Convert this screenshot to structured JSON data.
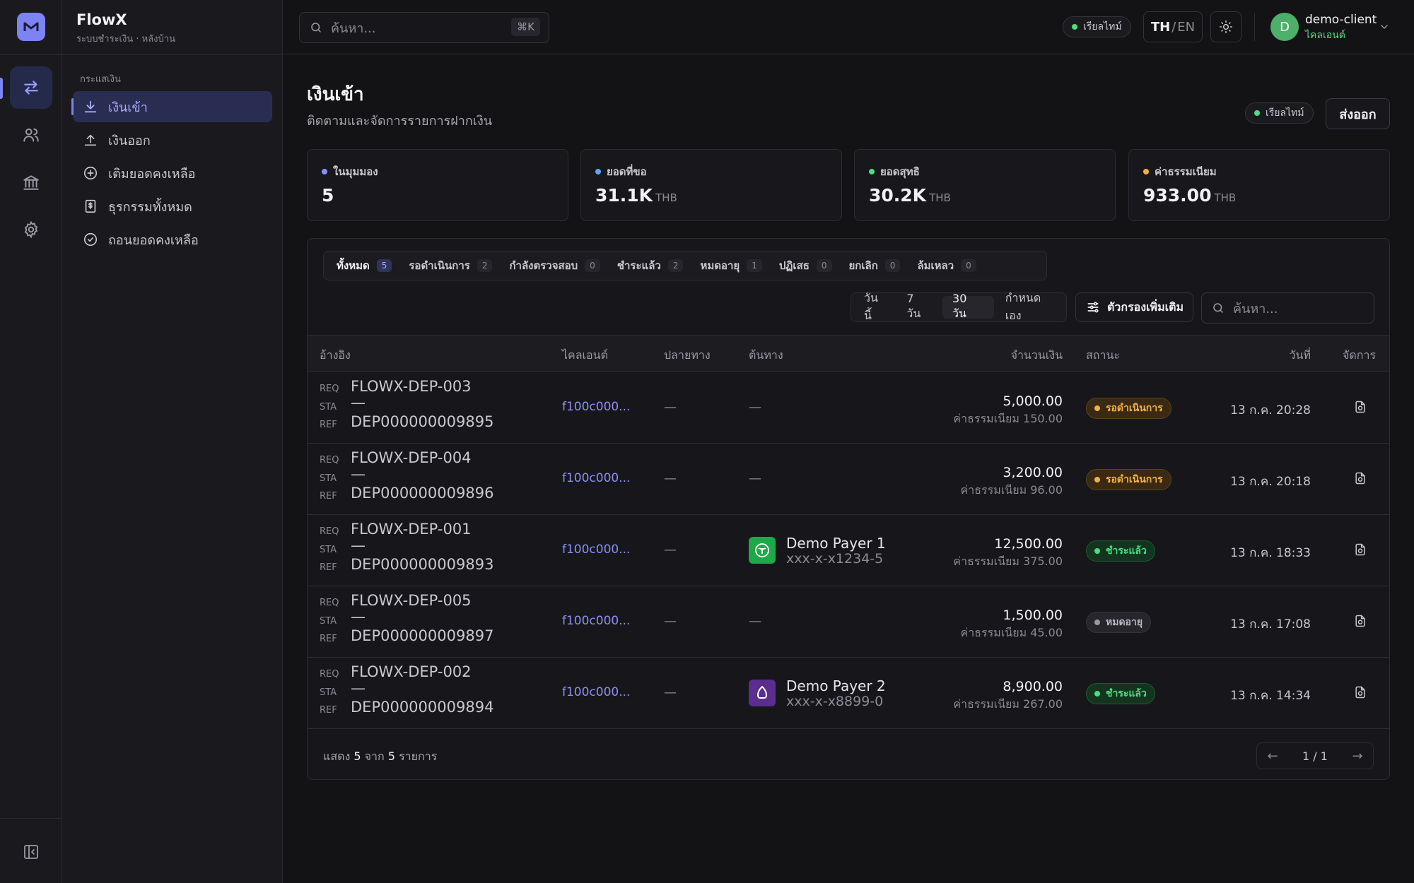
{
  "app": {
    "name": "FlowX",
    "subtitle": "ระบบชำระเงิน · หลังบ้าน"
  },
  "sidebar": {
    "section": "กระแสเงิน",
    "items": [
      {
        "label": "เงินเข้า",
        "icon": "download-icon",
        "active": true
      },
      {
        "label": "เงินออก",
        "icon": "upload-icon"
      },
      {
        "label": "เติมยอดคงเหลือ",
        "icon": "plus-circle-icon"
      },
      {
        "label": "ธุรกรรมทั้งหมด",
        "icon": "receipt-icon"
      },
      {
        "label": "ถอนยอดคงเหลือ",
        "icon": "check-circle-icon"
      }
    ]
  },
  "topbar": {
    "search_placeholder": "ค้นหา...",
    "search_shortcut": "⌘K",
    "live_label": "เรียลไทม์",
    "lang_active": "TH",
    "lang_sep": "/",
    "lang_other": "EN",
    "user": {
      "initial": "D",
      "name": "demo-client",
      "role": "ไคลเอนต์"
    }
  },
  "page": {
    "title": "เงินเข้า",
    "subtitle": "ติดตามและจัดการรายการฝากเงิน",
    "live_label": "เรียลไทม์",
    "export_label": "ส่งออก"
  },
  "stats": [
    {
      "label": "ในมุมมอง",
      "value": "5",
      "unit": "",
      "color": "#8b8ff5"
    },
    {
      "label": "ยอดที่ขอ",
      "value": "31.1K",
      "unit": "THB",
      "color": "#60a5fa"
    },
    {
      "label": "ยอดสุทธิ",
      "value": "30.2K",
      "unit": "THB",
      "color": "#4ade80"
    },
    {
      "label": "ค่าธรรมเนียม",
      "value": "933.00",
      "unit": "THB",
      "color": "#f5b042"
    }
  ],
  "tabs": [
    {
      "label": "ทั้งหมด",
      "count": "5",
      "active": true
    },
    {
      "label": "รอดำเนินการ",
      "count": "2"
    },
    {
      "label": "กำลังตรวจสอบ",
      "count": "0"
    },
    {
      "label": "ชำระแล้ว",
      "count": "2"
    },
    {
      "label": "หมดอายุ",
      "count": "1"
    },
    {
      "label": "ปฏิเสธ",
      "count": "0"
    },
    {
      "label": "ยกเลิก",
      "count": "0"
    },
    {
      "label": "ล้มเหลว",
      "count": "0"
    }
  ],
  "ranges": [
    {
      "label": "วันนี้"
    },
    {
      "label": "7 วัน"
    },
    {
      "label": "30 วัน",
      "active": true
    },
    {
      "label": "กำหนดเอง"
    }
  ],
  "filter_label": "ตัวกรองเพิ่มเติม",
  "table_search_placeholder": "ค้นหา...",
  "columns": {
    "ref": "อ้างอิง",
    "client": "ไคลเอนต์",
    "destination": "ปลายทาง",
    "source": "ต้นทาง",
    "amount": "จำนวนเงิน",
    "status": "สถานะ",
    "date": "วันที่",
    "actions": "จัดการ"
  },
  "ref_labels": {
    "req": "REQ",
    "sta": "STA",
    "ref": "REF"
  },
  "rows": [
    {
      "req": "FLOWX-DEP-003",
      "sta": "—",
      "ref": "DEP000000009895",
      "client": "f100c000...",
      "destination": "—",
      "source": null,
      "source_empty": "—",
      "amount": "5,000.00",
      "fee": "ค่าธรรมเนียม 150.00",
      "status": "รอดำเนินการ",
      "status_kind": "pending",
      "date": "13 ก.ค. 20:28"
    },
    {
      "req": "FLOWX-DEP-004",
      "sta": "—",
      "ref": "DEP000000009896",
      "client": "f100c000...",
      "destination": "—",
      "source": null,
      "source_empty": "—",
      "amount": "3,200.00",
      "fee": "ค่าธรรมเนียม 96.00",
      "status": "รอดำเนินการ",
      "status_kind": "pending",
      "date": "13 ก.ค. 20:18"
    },
    {
      "req": "FLOWX-DEP-001",
      "sta": "—",
      "ref": "DEP000000009893",
      "client": "f100c000...",
      "destination": "—",
      "source": {
        "name": "Demo Payer 1",
        "account": "xxx-x-x1234-5",
        "bank_color": "#1ea84a",
        "icon": "kbank-logo-icon"
      },
      "amount": "12,500.00",
      "fee": "ค่าธรรมเนียม 375.00",
      "status": "ชำระแล้ว",
      "status_kind": "paid",
      "date": "13 ก.ค. 18:33"
    },
    {
      "req": "FLOWX-DEP-005",
      "sta": "—",
      "ref": "DEP000000009897",
      "client": "f100c000...",
      "destination": "—",
      "source": null,
      "source_empty": "—",
      "amount": "1,500.00",
      "fee": "ค่าธรรมเนียม 45.00",
      "status": "หมดอายุ",
      "status_kind": "expired",
      "date": "13 ก.ค. 17:08"
    },
    {
      "req": "FLOWX-DEP-002",
      "sta": "—",
      "ref": "DEP000000009894",
      "client": "f100c000...",
      "destination": "—",
      "source": {
        "name": "Demo Payer 2",
        "account": "xxx-x-x8899-0",
        "bank_color": "#5b2d8e",
        "icon": "scb-logo-icon"
      },
      "amount": "8,900.00",
      "fee": "ค่าธรรมเนียม 267.00",
      "status": "ชำระแล้ว",
      "status_kind": "paid",
      "date": "13 ก.ค. 14:34"
    }
  ],
  "footer": {
    "prefix": "แสดง",
    "shown": "5",
    "mid": "จาก",
    "total": "5",
    "suffix": "รายการ",
    "page": "1 / 1",
    "prev": "←",
    "next": "→"
  }
}
